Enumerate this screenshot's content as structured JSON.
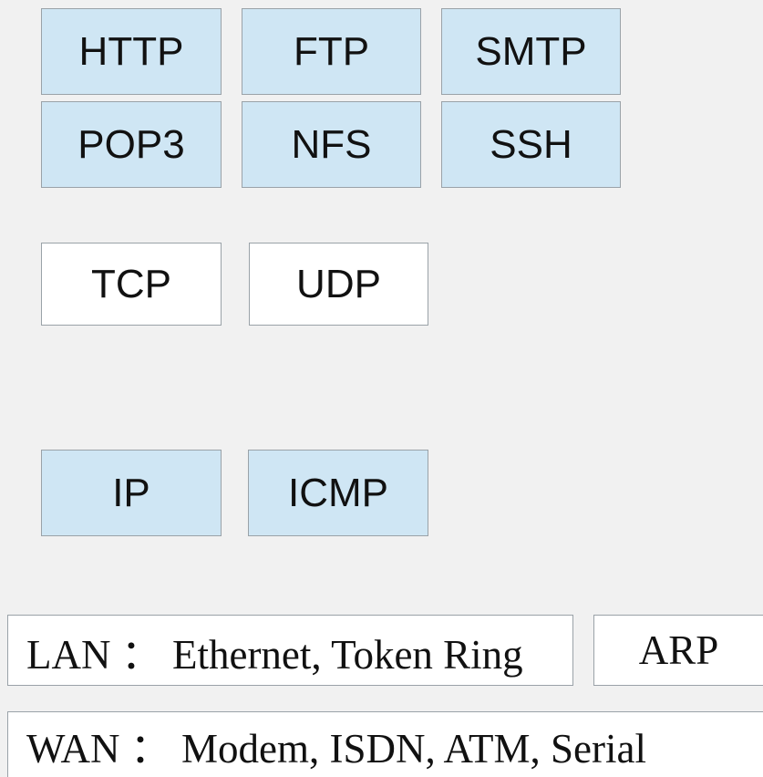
{
  "application_layer": [
    "HTTP",
    "FTP",
    "SMTP",
    "POP3",
    "NFS",
    "SSH"
  ],
  "transport_layer": [
    "TCP",
    "UDP"
  ],
  "network_layer": [
    "IP",
    "ICMP"
  ],
  "link_layer": {
    "lan": "LAN ： Ethernet, Token Ring",
    "arp": "ARP",
    "wan": "WAN ： Modem, ISDN, ATM, Serial"
  },
  "colors": {
    "background": "#f1f1f1",
    "protocol_fill": "#cfe6f4",
    "plain_fill": "#ffffff",
    "border": "#9aa2a8"
  }
}
